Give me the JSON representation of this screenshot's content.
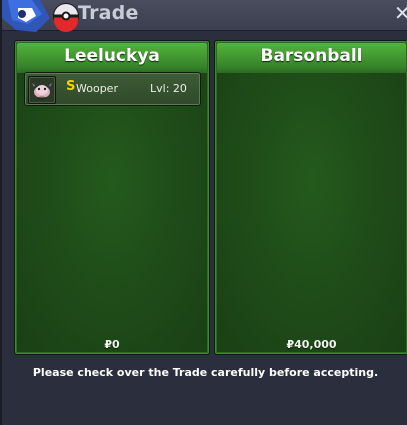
{
  "window": {
    "title": "Trade",
    "close_symbol": "✕"
  },
  "left_panel": {
    "player_name": "Leeluckya",
    "money": "₽0",
    "items": [
      {
        "shiny_mark": "S",
        "name": "Wooper",
        "level": "Lvl: 20",
        "icon": "wooper-icon"
      }
    ]
  },
  "right_panel": {
    "player_name": "Barsonball",
    "money": "₽40,000",
    "items": []
  },
  "footer": {
    "message": "Please check over the Trade carefully before accepting."
  },
  "colors": {
    "panel_green": "#245a1c",
    "header_green": "#54b33c",
    "shiny_yellow": "#f2d400"
  }
}
